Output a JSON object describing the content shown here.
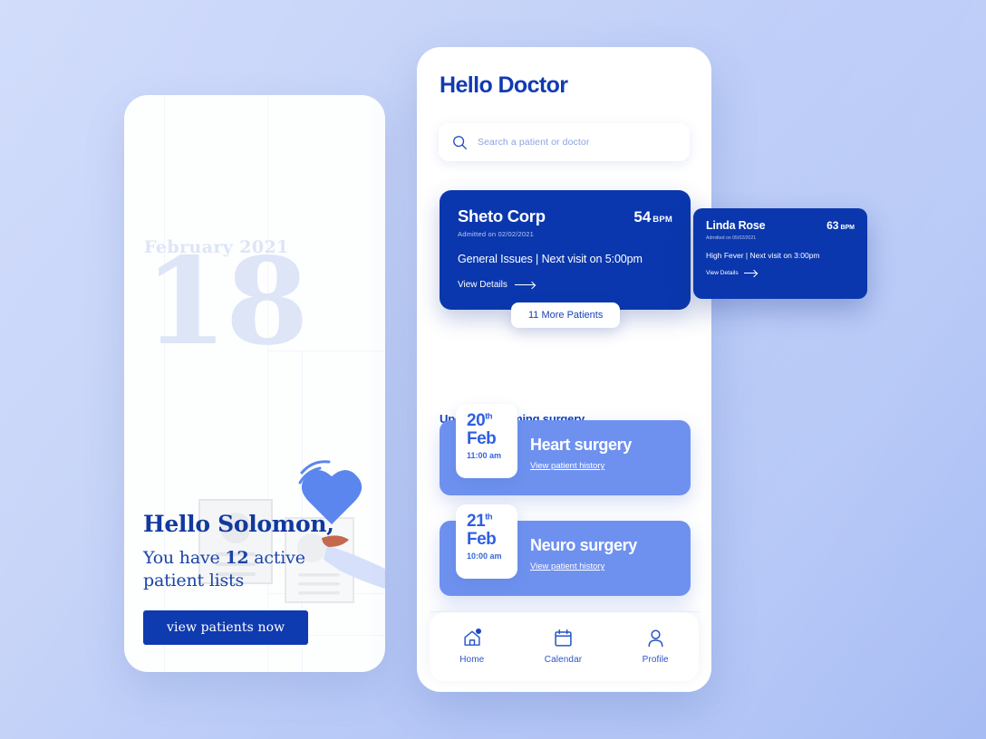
{
  "theme": {
    "background_start": "#c9d6fa",
    "background_end": "#a7bcf4",
    "deep_blue": "#0a37ad",
    "accent_blue": "#6e91ef",
    "text_blue": "#113bb2",
    "muted_blue": "#dde5f7"
  },
  "left_screen": {
    "calendar": {
      "month_year": "February 2021",
      "day": "18"
    },
    "illustration_name": "patient-records-heart-illustration",
    "greeting": "Hello Solomon,",
    "subtitle_prefix": "You have ",
    "subtitle_count": "12",
    "subtitle_suffix": " active patient lists",
    "cta_label": "view patients now"
  },
  "right_screen": {
    "title": "Hello Doctor",
    "search": {
      "placeholder": "Search a patient or doctor",
      "value": "",
      "icon": "search-icon"
    },
    "primary_patient": {
      "name": "Sheto Corp",
      "bpm_value": "54",
      "bpm_unit": "BPM",
      "admitted": "Admitted on 02/02/2021",
      "detail": "General Issues | Next visit on 5:00pm",
      "link_label": "View Details"
    },
    "secondary_patient": {
      "name": "Linda Rose",
      "bpm_value": "63",
      "bpm_unit": "BPM",
      "admitted": "Admitted on 05/02/2021",
      "detail": "High Fever | Next visit on 3:00pm",
      "link_label": "View Details"
    },
    "more_patients_pill": "11 More Patients",
    "surgery_section_title": "Upcoming coming surgery",
    "surgeries": [
      {
        "day": "20",
        "day_suffix": "th",
        "month": "Feb",
        "time": "11:00 am",
        "name": "Heart surgery",
        "link_label": "View patient history"
      },
      {
        "day": "21",
        "day_suffix": "th",
        "month": "Feb",
        "time": "10:00 am",
        "name": "Neuro surgery",
        "link_label": "View patient history"
      }
    ],
    "nav": [
      {
        "label": "Home",
        "icon": "home-icon",
        "has_badge": true
      },
      {
        "label": "Calendar",
        "icon": "calendar-icon",
        "has_badge": false
      },
      {
        "label": "Profile",
        "icon": "person-icon",
        "has_badge": false
      }
    ]
  }
}
